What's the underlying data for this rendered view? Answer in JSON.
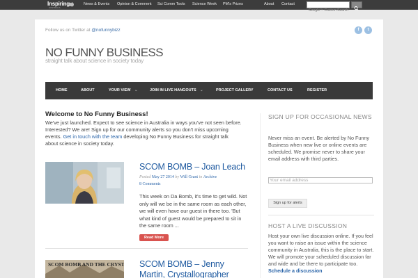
{
  "topbar": {
    "logo_text": "Inspiring",
    "logo_sub": "AUSTRALIA",
    "nav": [
      {
        "label": "News & Events"
      },
      {
        "label": "Opinion & Comment"
      },
      {
        "label": "Sci Comm Tools"
      },
      {
        "label": "Science Week"
      },
      {
        "label": "PM's Prizes"
      }
    ],
    "right_nav": [
      {
        "label": "About"
      },
      {
        "label": "Contact"
      }
    ],
    "search_placeholder": "Google™ Custom Search"
  },
  "header": {
    "follow_prefix": "Follow us on Twitter at",
    "twitter_handle": "@nofunnybizz",
    "site_title": "NO FUNNY BUSINESS",
    "tagline": "straight talk about science in society today",
    "social_icons": [
      {
        "glyph": "f"
      },
      {
        "glyph": "t"
      }
    ]
  },
  "mainnav": {
    "items": [
      {
        "label": "HOME"
      },
      {
        "label": "ABOUT"
      },
      {
        "label": "YOUR VIEW"
      },
      {
        "label": "JOIN IN LIVE HANGOUTS"
      },
      {
        "label": "PROJECT GALLERY"
      },
      {
        "label": "CONTACT US"
      },
      {
        "label": "REGISTER"
      }
    ]
  },
  "welcome": {
    "heading": "Welcome to No Funny Business!",
    "text_before": "We've just launched. Expect to see science in Australia in ways you've not seen before. Interested? We are! Sign up for our community alerts so you don't miss upcoming events.",
    "link_text": "Get in touch with the team",
    "text_after": "developing No Funny Business for straight talk about science in society today."
  },
  "posts": [
    {
      "title": "SCOM BOMB – Joan Leach",
      "posted_label": "Posted",
      "date": "May 27 2014",
      "by_label": "by",
      "author": "Will Grant",
      "in_label": "in",
      "category": "Archive",
      "comments": "8 Comments",
      "excerpt": "This week on Da Bomb, it's time to get wild. Not only will we be in the same room as each other, we will even have our guest in there too. 'But what kind of guest would be prepared to sit in the same room ...",
      "read_more": "Read More"
    },
    {
      "title": "SCOM BOMB – Jenny Martin, Crystallographer",
      "thumb_caption": "SCOM BOMB AND THE CRYSTAL CAVE"
    }
  ],
  "sidebar": {
    "signup_heading": "SIGN UP FOR OCCASIONAL NEWS",
    "signup_text": "Never miss an event. Be alerted by No Funny Business when new live or online events are scheduled. We promise never to share your email address with third parties.",
    "email_placeholder": "Your email address",
    "signup_button": "Sign up for alerts",
    "host_heading": "HOST A LIVE DISCUSSION",
    "host_text": "Host your own live discussion online. If you feel you want to raise an issue within the science community in Australia, this is the place to start. We will promote your scheduled discussion far and wide and be there to participate too.",
    "host_link": "Schedule a discussion"
  }
}
